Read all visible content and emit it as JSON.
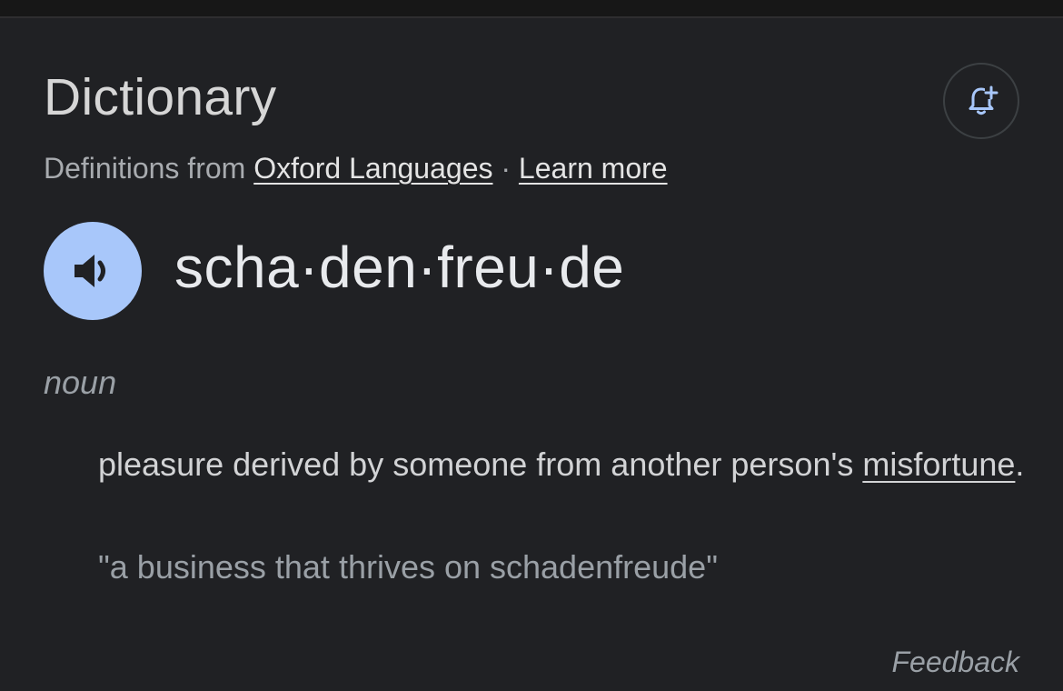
{
  "card": {
    "title": "Dictionary",
    "source_prefix": "Definitions from",
    "source_link": "Oxford Languages",
    "separator": "·",
    "learn_more": "Learn more",
    "add_alert_icon": "bell-plus-icon",
    "accent_color": "#a8c7fa"
  },
  "entry": {
    "audio_icon": "speaker-icon",
    "headword": "scha·den·freu·de",
    "part_of_speech": "noun",
    "definition_before": "pleasure derived by someone from another person's ",
    "definition_link": "misfortune",
    "definition_after": ".",
    "example": "\"a business that thrives on schadenfreude\""
  },
  "footer": {
    "feedback": "Feedback"
  }
}
